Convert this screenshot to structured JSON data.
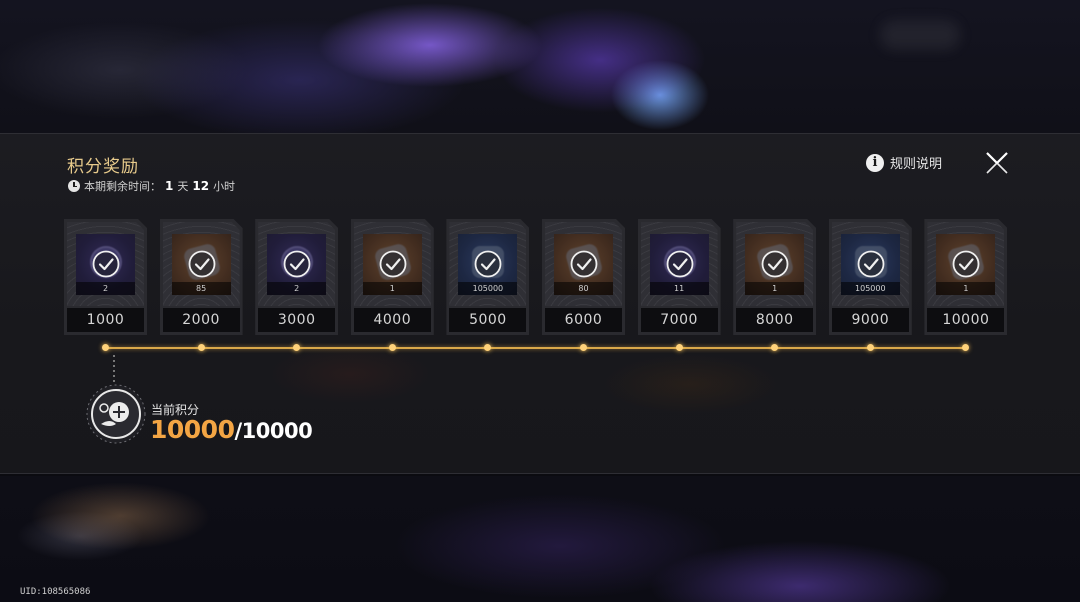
{
  "header": {
    "title": "积分奖励",
    "timer_label": "本期剩余时间：",
    "timer_days": "1",
    "timer_days_unit": "天",
    "timer_hours": "12",
    "timer_hours_unit": "小时",
    "rules_label": "规则说明"
  },
  "rewards": [
    {
      "score": "1000",
      "quantity": "2",
      "icon": "purple-orb-item",
      "claimed": true
    },
    {
      "score": "2000",
      "quantity": "85",
      "icon": "blue-crystal-item",
      "claimed": true
    },
    {
      "score": "3000",
      "quantity": "2",
      "icon": "purple-orb-item",
      "claimed": true
    },
    {
      "score": "4000",
      "quantity": "1",
      "icon": "metal-box-item",
      "claimed": true
    },
    {
      "score": "5000",
      "quantity": "105000",
      "icon": "blue-crate-item",
      "claimed": true
    },
    {
      "score": "6000",
      "quantity": "80",
      "icon": "blue-crystal-item",
      "claimed": true
    },
    {
      "score": "7000",
      "quantity": "11",
      "icon": "gold-scroll-item",
      "claimed": true
    },
    {
      "score": "8000",
      "quantity": "1",
      "icon": "brown-box-item",
      "claimed": true
    },
    {
      "score": "9000",
      "quantity": "105000",
      "icon": "blue-crate-item",
      "claimed": true
    },
    {
      "score": "10000",
      "quantity": "1",
      "icon": "gem-pile-item",
      "claimed": true
    }
  ],
  "progress": {
    "label": "当前积分",
    "current": "10000",
    "max": "/10000",
    "fraction": 1.0
  },
  "footer": {
    "uid": "UID:108565086"
  },
  "colors": {
    "accent_gold": "#e8cb8c",
    "score_orange": "#f3a544",
    "track": "#d9a84a"
  }
}
